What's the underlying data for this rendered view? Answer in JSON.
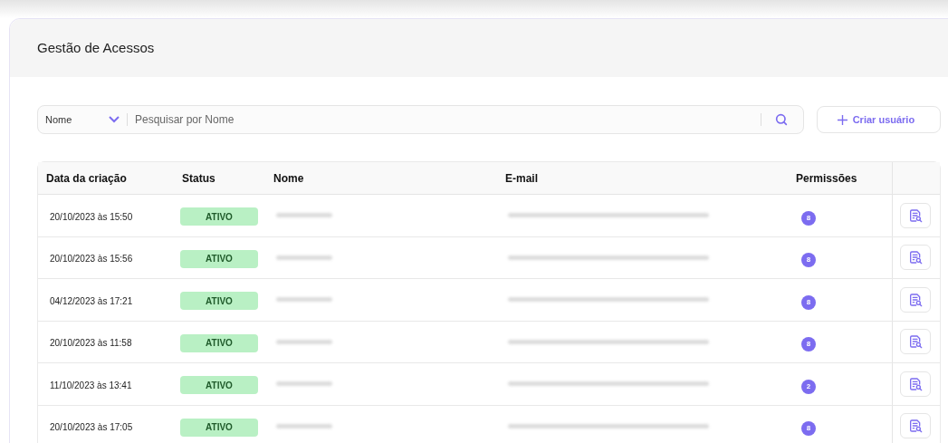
{
  "page": {
    "title": "Gestão de Acessos"
  },
  "search": {
    "filter": "Nome",
    "placeholder": "Pesquisar por Nome"
  },
  "create_button": {
    "label": "Criar usuário"
  },
  "table": {
    "columns": [
      "Data da criação",
      "Status",
      "Nome",
      "E-mail",
      "Permissões"
    ],
    "rows": [
      {
        "created": "20/10/2023 às 15:50",
        "status": "ATIVO",
        "permissions": "8"
      },
      {
        "created": "20/10/2023 às 15:56",
        "status": "ATIVO",
        "permissions": "8"
      },
      {
        "created": "04/12/2023 às 17:21",
        "status": "ATIVO",
        "permissions": "8"
      },
      {
        "created": "20/10/2023 às 11:58",
        "status": "ATIVO",
        "permissions": "8"
      },
      {
        "created": "11/10/2023 às 13:41",
        "status": "ATIVO",
        "permissions": "2"
      },
      {
        "created": "20/10/2023 às 17:05",
        "status": "ATIVO",
        "permissions": "8"
      }
    ]
  }
}
